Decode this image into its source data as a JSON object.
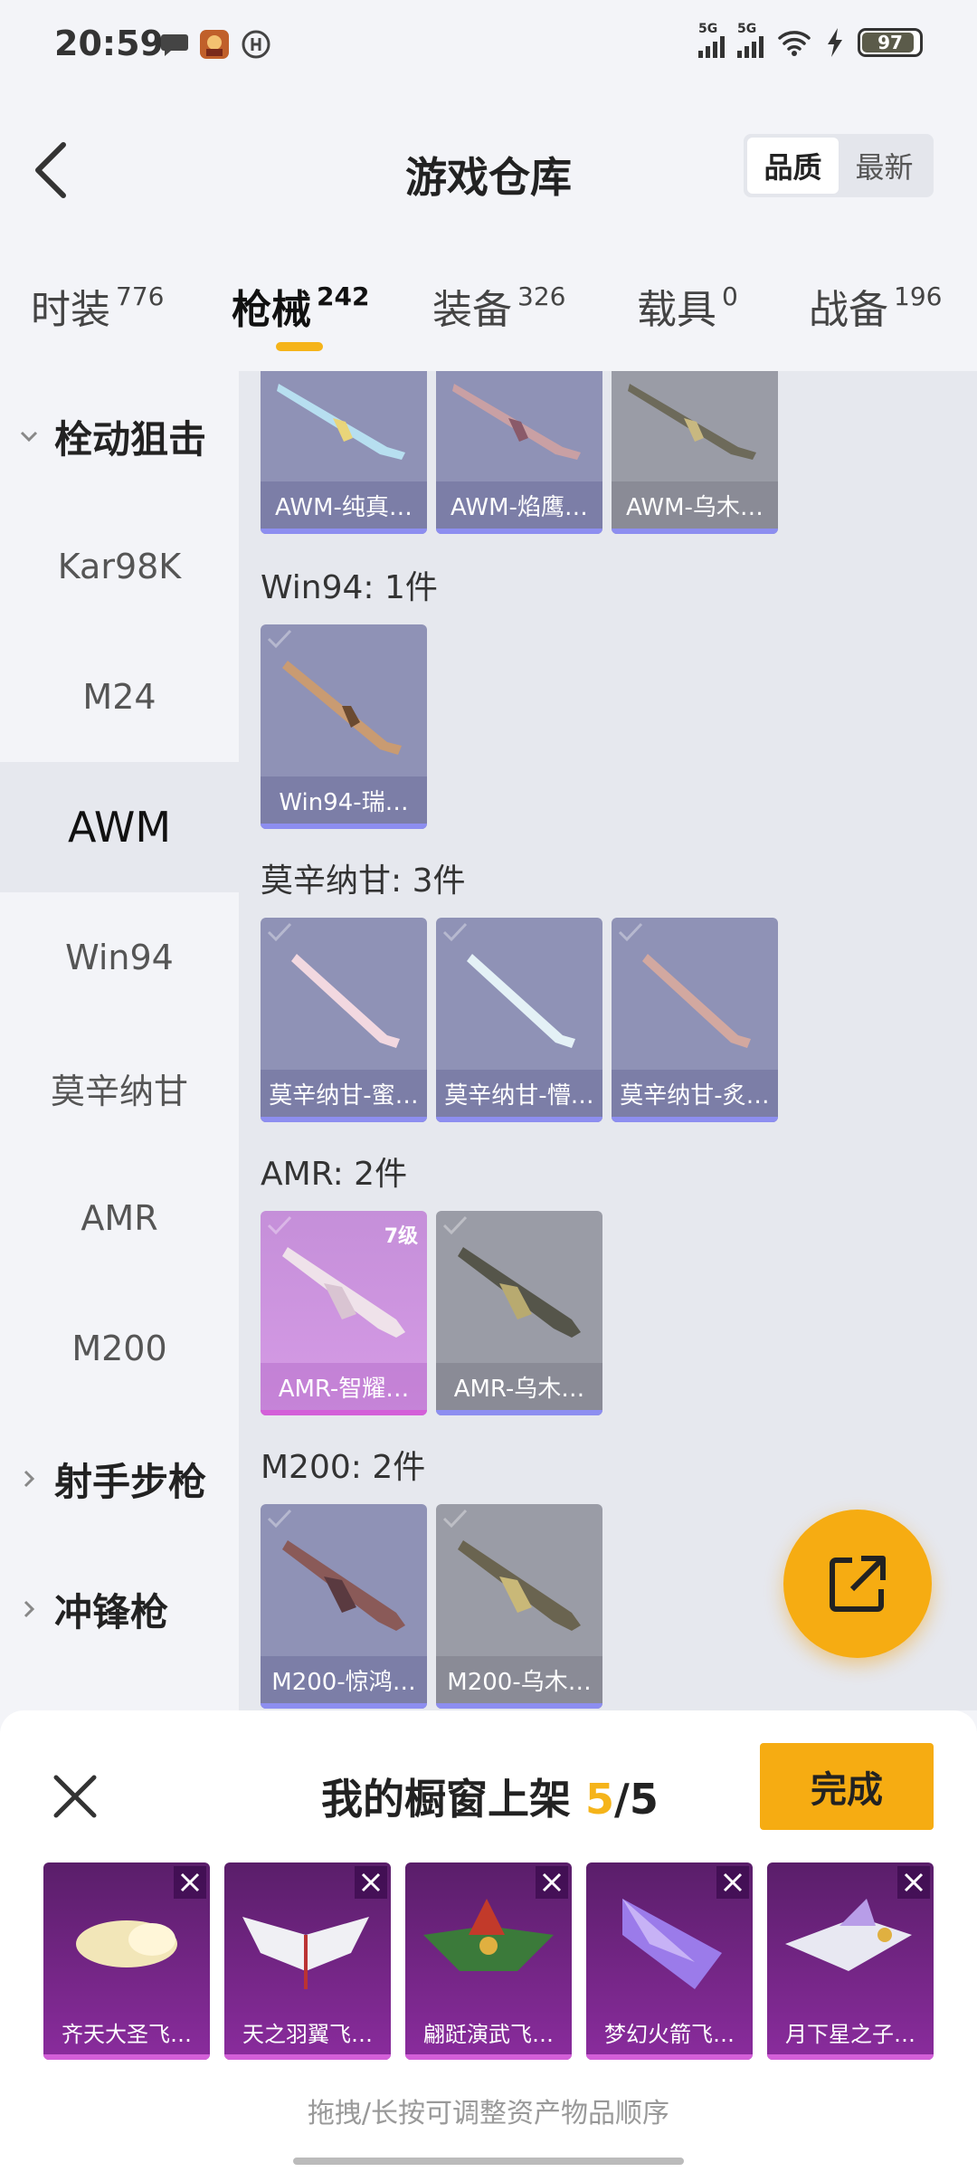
{
  "status": {
    "time": "20:59",
    "net1": "5G",
    "net2": "5G",
    "battery": "97"
  },
  "header": {
    "title": "游戏仓库",
    "sort": [
      "品质",
      "最新"
    ]
  },
  "tabs": [
    {
      "label": "时装",
      "count": "776"
    },
    {
      "label": "枪械",
      "count": "242"
    },
    {
      "label": "装备",
      "count": "326"
    },
    {
      "label": "载具",
      "count": "0"
    },
    {
      "label": "战备",
      "count": "196"
    }
  ],
  "sidebar": [
    {
      "label": "栓动狙击",
      "kind": "group-open"
    },
    {
      "label": "Kar98K"
    },
    {
      "label": "M24"
    },
    {
      "label": "AWM",
      "active": true
    },
    {
      "label": "Win94"
    },
    {
      "label": "莫辛纳甘"
    },
    {
      "label": "AMR"
    },
    {
      "label": "M200"
    },
    {
      "label": "射手步枪",
      "kind": "group-closed"
    },
    {
      "label": "冲锋枪",
      "kind": "group-closed"
    }
  ],
  "sections": {
    "awm": {
      "items": [
        "AWM-纯真…",
        "AWM-焰鹰…",
        "AWM-乌木…"
      ]
    },
    "win94": {
      "title": "Win94: 1件",
      "items": [
        "Win94-瑞…"
      ]
    },
    "mosin": {
      "title": "莫辛纳甘: 3件",
      "items": [
        "莫辛纳甘-蜜…",
        "莫辛纳甘-懵…",
        "莫辛纳甘-炙…"
      ]
    },
    "amr": {
      "title": "AMR: 2件",
      "items": [
        "AMR-智耀…",
        "AMR-乌木…"
      ],
      "level": "7级"
    },
    "m200": {
      "title": "M200: 2件",
      "items": [
        "M200-惊鸿…",
        "M200-乌木…"
      ]
    }
  },
  "sheet": {
    "title_prefix": "我的橱窗上架",
    "current": "5",
    "total": "/5",
    "done": "完成",
    "slots": [
      "齐天大圣飞…",
      "天之羽翼飞…",
      "翩跹演武飞…",
      "梦幻火箭飞…",
      "月下星之子…"
    ],
    "hint": "拖拽/长按可调整资产物品顺序"
  },
  "colors": {
    "accent": "#f6ac12",
    "epic": "#8d8ef0",
    "legendary": "#d35fd8"
  }
}
